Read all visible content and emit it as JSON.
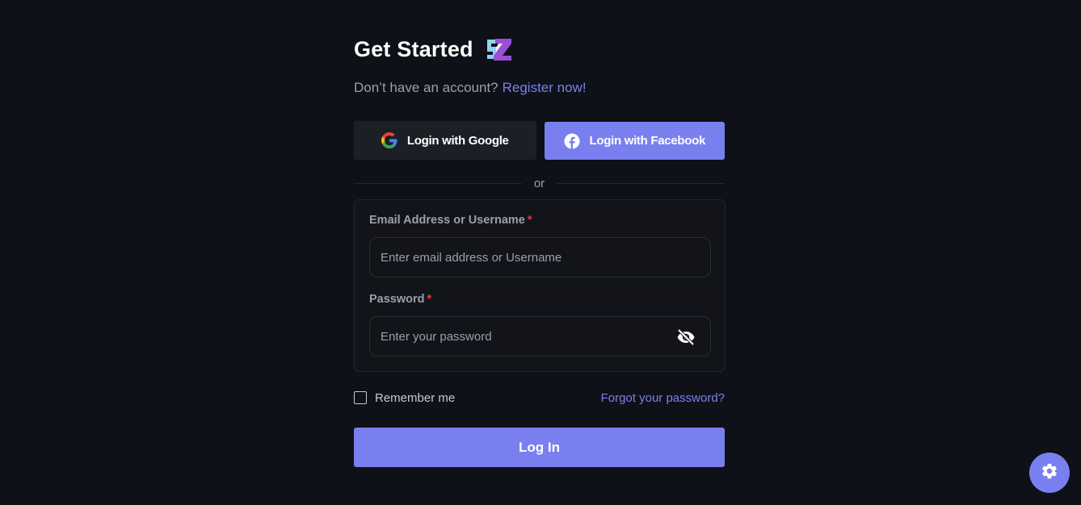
{
  "header": {
    "title": "Get Started",
    "logo_letters": "SZ"
  },
  "register": {
    "prompt": "Don’t have an account?",
    "link": "Register now!"
  },
  "social": {
    "google_label": "Login with Google",
    "facebook_label": "Login with Facebook",
    "google_icon": "google-icon",
    "facebook_icon": "facebook-icon"
  },
  "divider_text": "or",
  "form": {
    "email_label": "Email Address or Username",
    "email_placeholder": "Enter email address or Username",
    "email_value": "",
    "password_label": "Password",
    "password_placeholder": "Enter your password",
    "password_value": "",
    "required_marker": "*",
    "eye_icon": "eye-slash-icon"
  },
  "options": {
    "remember_label": "Remember me",
    "remember_checked": false,
    "forgot_label": "Forgot your password?"
  },
  "submit_label": "Log In",
  "settings_icon": "gear-icon",
  "colors": {
    "background": "#0e1117",
    "accent": "#7a7ff0",
    "link": "#7b80f2",
    "required": "#e53a3a"
  }
}
